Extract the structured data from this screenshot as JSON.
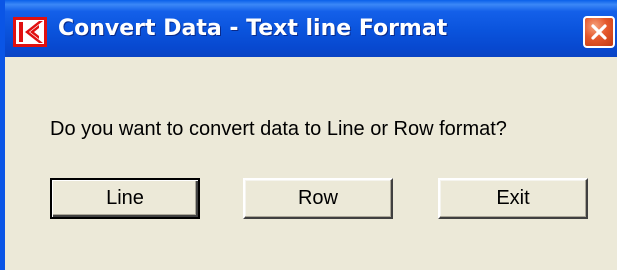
{
  "window": {
    "title": "Convert Data - Text line Format",
    "icon": "app-logo-icon",
    "close_icon": "close-icon"
  },
  "dialog": {
    "message": "Do you want to convert data to Line or Row format?",
    "buttons": {
      "line_label": "Line",
      "row_label": "Row",
      "exit_label": "Exit"
    }
  },
  "colors": {
    "titlebar": "#0a53dc",
    "window_bg": "#ece9d8",
    "close_button": "#e5582c",
    "app_icon_red": "#e01010"
  }
}
